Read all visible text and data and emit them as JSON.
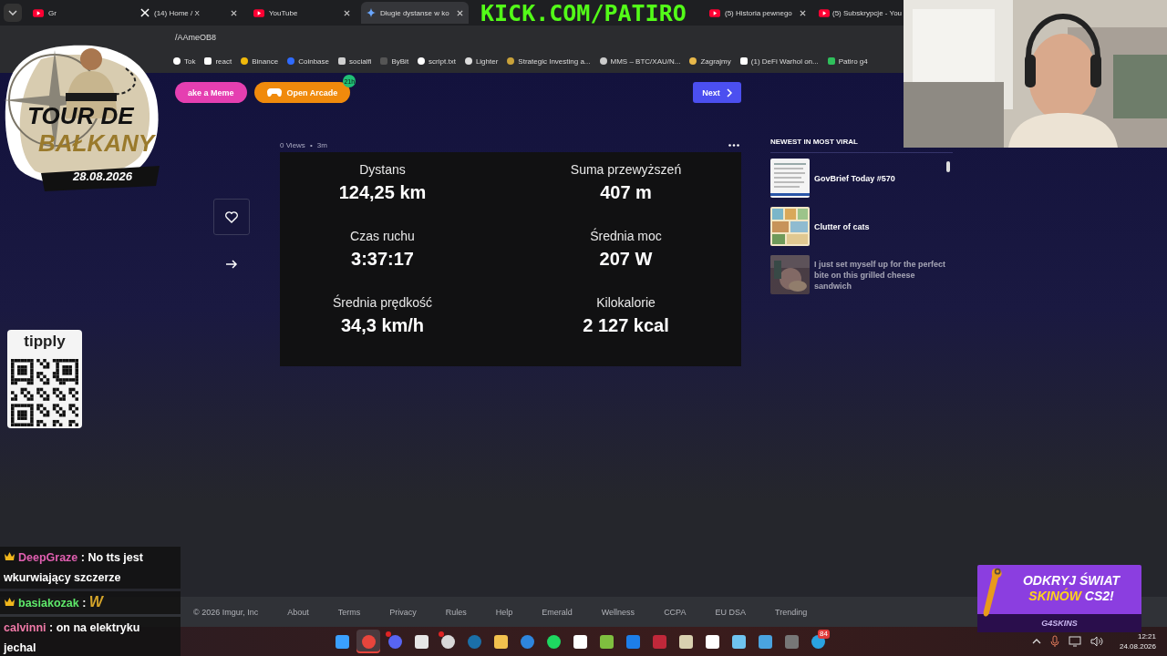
{
  "browser": {
    "tabs": [
      {
        "title": "Gr",
        "selected": false
      },
      {
        "title": "(14) Home / X",
        "selected": false
      },
      {
        "title": "YouTube",
        "selected": false
      },
      {
        "title": "Długie dystanse w ko",
        "selected": true
      },
      {
        "title": "(5) Historia pewnego",
        "selected": false
      },
      {
        "title": "(5) Subskrypcje - You",
        "selected": false
      }
    ],
    "address": "/AAmeOB8",
    "bookmarks": [
      "Tok",
      "react",
      "Binance",
      "Coinbase",
      "socialfi",
      "ByBit",
      "script.txt",
      "Lighter",
      "Strategic Investing a...",
      "MMS – BTC/XAU/N...",
      "Zagrajmy",
      "(1) DeFi Warhol on...",
      "Patiro g4"
    ]
  },
  "imgur": {
    "actions": [
      {
        "kind": "meme",
        "label": "ake a Meme"
      },
      {
        "kind": "arcade",
        "label": "Open Arcade",
        "badge": "21h"
      }
    ],
    "next": "Next",
    "views": "0 Views",
    "dot": "•",
    "age": "3m",
    "stats": [
      {
        "label": "Dystans",
        "value": "124,25 km"
      },
      {
        "label": "Suma przewyższeń",
        "value": "407 m"
      },
      {
        "label": "Czas ruchu",
        "value": "3:37:17"
      },
      {
        "label": "Średnia moc",
        "value": "207 W"
      },
      {
        "label": "Średnia prędkość",
        "value": "34,3 km/h"
      },
      {
        "label": "Kilokalorie",
        "value": "2 127 kcal"
      }
    ],
    "sidebar": {
      "heading": "NEWEST IN MOST VIRAL",
      "items": [
        {
          "title": "GovBrief Today #570",
          "faded": false
        },
        {
          "title": "Clutter of cats",
          "faded": false
        },
        {
          "title": "I just set myself up for the perfect bite on this grilled cheese sandwich",
          "faded": true
        }
      ]
    },
    "footer": [
      "© 2026 Imgur, Inc",
      "About",
      "Terms",
      "Privacy",
      "Rules",
      "Help",
      "Emerald",
      "Wellness",
      "CCPA",
      "EU DSA",
      "Trending"
    ]
  },
  "overlay": {
    "kick": "KICK.COM/PATIRO",
    "sticker": {
      "line1": "TOUR DE",
      "line2": "BAŁKANY",
      "date": "28.08.2026"
    },
    "tipply": "tipply",
    "chat": [
      {
        "user": "DeepGraze",
        "color": "#e05fb0",
        "badge": true,
        "sep": ":",
        "text": "No tts jest wkurwiający szczerze",
        "emote": false
      },
      {
        "user": "basiakozak",
        "color": "#5ee86a",
        "badge": true,
        "sep": ":",
        "text": "W",
        "emote": true
      },
      {
        "user": "calvinni",
        "color": "#f07aa8",
        "badge": false,
        "sep": ":",
        "text": "on na elektryku jechal",
        "emote": false
      }
    ],
    "ad": {
      "line1": "ODKRYJ ŚWIAT",
      "highlight": "SKINÓW",
      "rest": "CS2!",
      "brand": "G4SKINS"
    }
  },
  "taskbar": {
    "apps": [
      {
        "selected": false,
        "dot": false
      },
      {
        "selected": true,
        "dot": false
      },
      {
        "selected": false,
        "dot": true
      },
      {
        "selected": false,
        "dot": false
      },
      {
        "selected": false,
        "dot": true
      },
      {
        "selected": false,
        "dot": false
      },
      {
        "selected": false,
        "dot": false
      },
      {
        "selected": false,
        "dot": false
      },
      {
        "selected": false,
        "dot": false
      },
      {
        "selected": false,
        "dot": false
      },
      {
        "selected": false,
        "dot": false
      },
      {
        "selected": false,
        "dot": false
      },
      {
        "selected": false,
        "dot": false
      },
      {
        "selected": false,
        "dot": false
      },
      {
        "selected": false,
        "dot": false
      },
      {
        "selected": false,
        "dot": false
      },
      {
        "selected": false,
        "dot": false
      },
      {
        "selected": false,
        "dot": false
      },
      {
        "selected": false,
        "dot": false,
        "badge": "84"
      }
    ],
    "time": "12:21",
    "date": "24.08.2026"
  }
}
